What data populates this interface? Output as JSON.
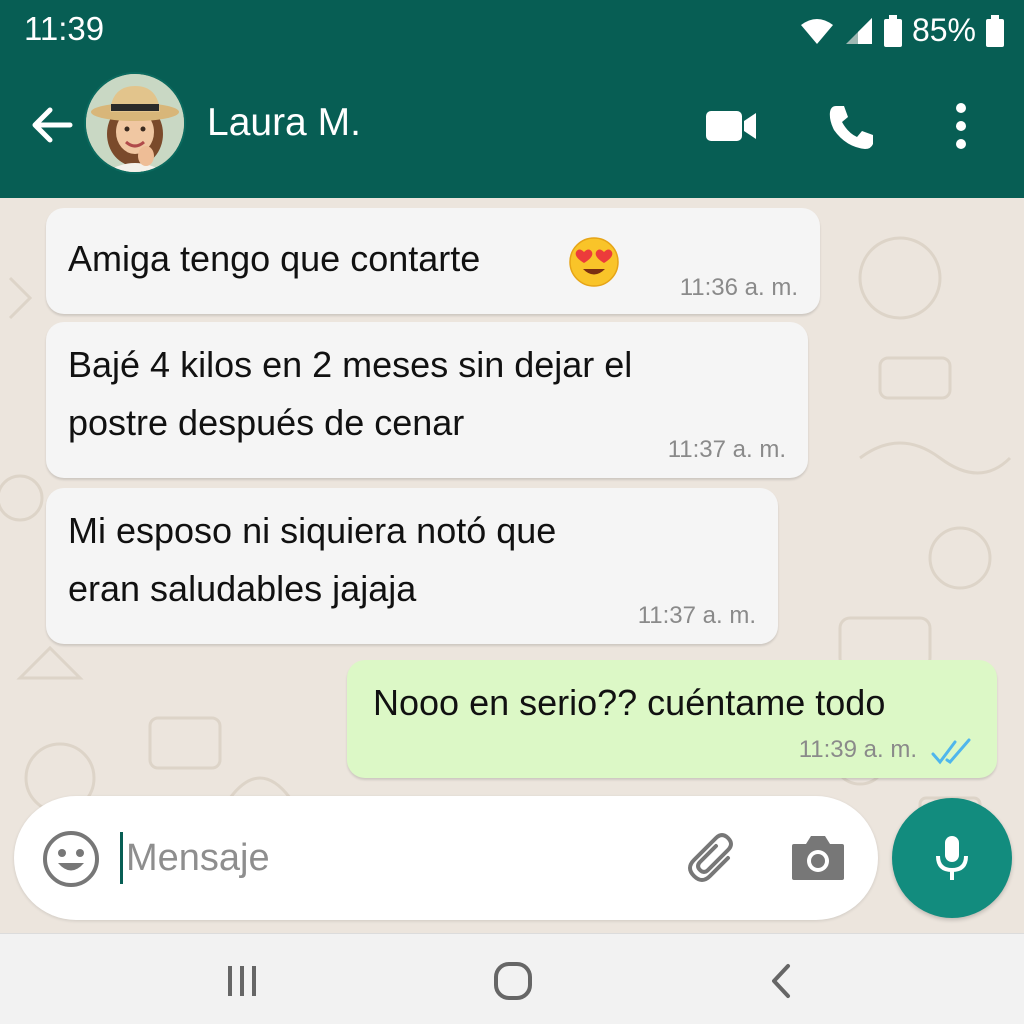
{
  "status_bar": {
    "time": "11:39",
    "battery": "85%"
  },
  "header": {
    "contact_name": "Laura M.",
    "icons": {
      "back": "arrow-left-icon",
      "video": "video-camera-icon",
      "call": "phone-icon",
      "menu": "more-vertical-icon"
    },
    "background_color": "#075e54"
  },
  "messages": [
    {
      "direction": "incoming",
      "text": "Amiga tengo que contarte",
      "emoji": "heart-eyes-emoji",
      "time": "11:36 a. m."
    },
    {
      "direction": "incoming",
      "lines": [
        "Bajé 4 kilos en 2 meses sin dejar el",
        "postre después de cenar"
      ],
      "time": "11:37 a. m."
    },
    {
      "direction": "incoming",
      "lines": [
        "Mi esposo ni siquiera notó que",
        "eran saludables jajaja"
      ],
      "time": "11:37 a. m."
    },
    {
      "direction": "outgoing",
      "text": "Nooo en serio?? cuéntame todo",
      "time": "11:39 a. m.",
      "status": "read"
    }
  ],
  "composer": {
    "placeholder": "Mensaje",
    "icons": {
      "emoji": "smiley-icon",
      "attach": "paperclip-icon",
      "camera": "camera-icon",
      "mic": "microphone-icon"
    }
  },
  "colors": {
    "incoming_bubble": "#f5f5f5",
    "outgoing_bubble": "#dcf8c6",
    "mic_button": "#128c7e",
    "read_ticks": "#4fb6ec"
  }
}
